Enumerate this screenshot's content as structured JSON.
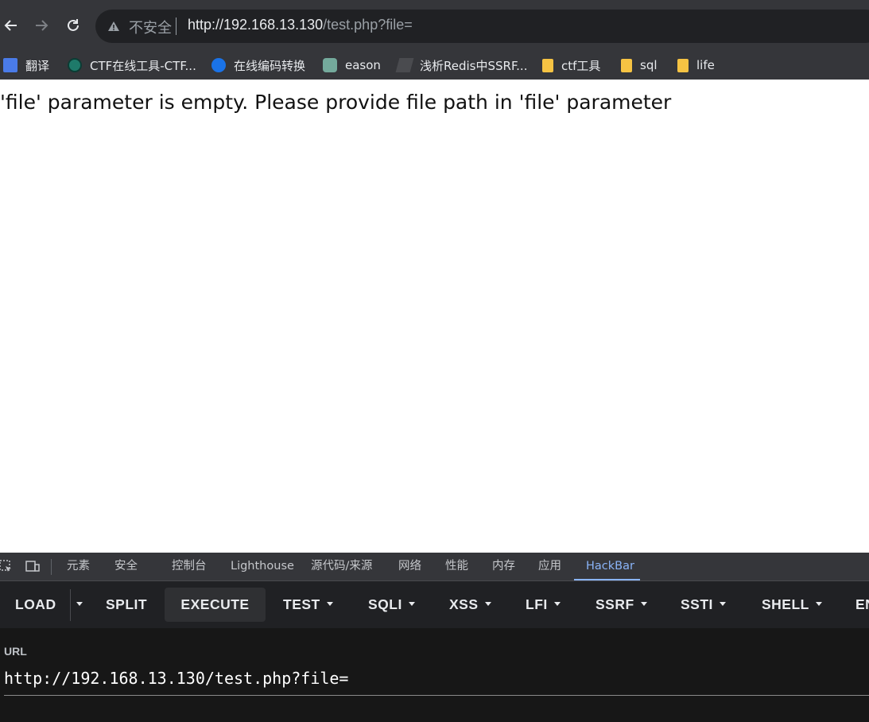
{
  "browser": {
    "insecure_label": "不安全",
    "url_host": "http://192.168.13.130",
    "url_path": "/test.php?file="
  },
  "bookmarks": [
    {
      "label": "翻译",
      "icon": "google-translate-icon"
    },
    {
      "label": "CTF在线工具-CTF...",
      "icon": "ctf-tools-icon"
    },
    {
      "label": "在线编码转换",
      "icon": "c-logo-icon"
    },
    {
      "label": "eason",
      "icon": "openai-icon"
    },
    {
      "label": "浅析Redis中SSRF...",
      "icon": "site-icon"
    },
    {
      "label": "ctf工具",
      "icon": "folder-icon"
    },
    {
      "label": "sql",
      "icon": "folder-icon"
    },
    {
      "label": "life",
      "icon": "folder-icon"
    }
  ],
  "page": {
    "message": "'file' parameter is empty. Please provide file path in 'file' parameter"
  },
  "devtools": {
    "tabs": [
      "元素",
      "安全",
      "控制台",
      "Lighthouse",
      "源代码/来源",
      "网络",
      "性能",
      "内存",
      "应用",
      "HackBar"
    ],
    "active_tab": "HackBar"
  },
  "hackbar": {
    "buttons": [
      "LOAD",
      "SPLIT",
      "EXECUTE",
      "TEST",
      "SQLI",
      "XSS",
      "LFI",
      "SSRF",
      "SSTI",
      "SHELL",
      "EN"
    ],
    "url_label": "URL",
    "url_value": "http://192.168.13.130/test.php?file="
  },
  "colors": {
    "chrome_bg": "#35363a",
    "omnibox_bg": "#202124",
    "accent": "#8ab4f8",
    "panel_bg": "#171717"
  }
}
